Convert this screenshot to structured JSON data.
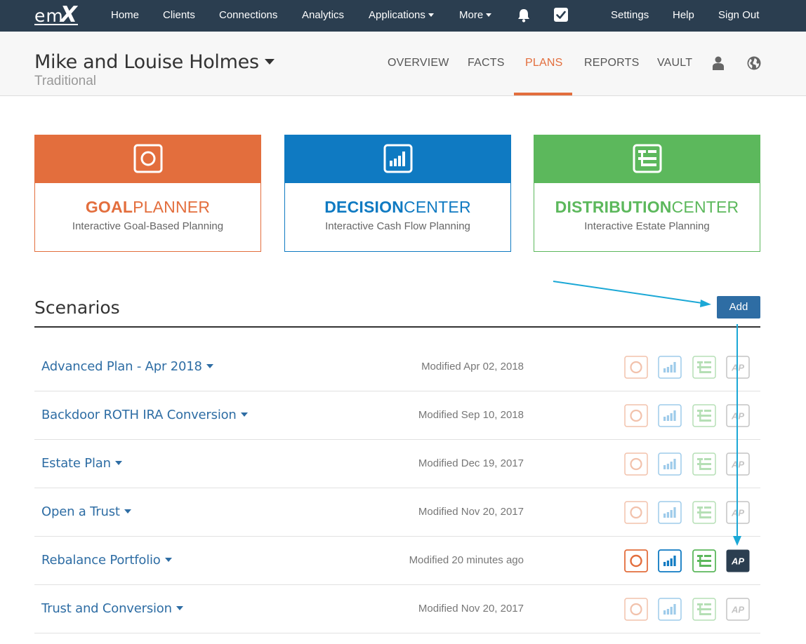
{
  "nav": {
    "logo_em": "em",
    "logo_x": "X",
    "home": "Home",
    "clients": "Clients",
    "connections": "Connections",
    "analytics": "Analytics",
    "applications": "Applications",
    "more": "More",
    "settings": "Settings",
    "help": "Help",
    "sign_out": "Sign Out",
    "bg_color": "#2b3e50"
  },
  "client": {
    "name": "Mike and Louise Holmes",
    "subtitle": "Traditional"
  },
  "tabs": [
    {
      "label": "OVERVIEW",
      "active": false
    },
    {
      "label": "FACTS",
      "active": false
    },
    {
      "label": "PLANS",
      "active": true
    },
    {
      "label": "REPORTS",
      "active": false
    },
    {
      "label": "VAULT",
      "active": false
    }
  ],
  "header_icons": [
    "user-icon",
    "globe-icon"
  ],
  "planners": [
    {
      "bold": "GOAL",
      "light": "PLANNER",
      "subtitle": "Interactive Goal-Based Planning",
      "color": "#e36e3d",
      "icon": "goal-planner-icon"
    },
    {
      "bold": "DECISION",
      "light": "CENTER",
      "subtitle": "Interactive Cash Flow Planning",
      "color": "#0f7ac2",
      "icon": "decision-center-icon"
    },
    {
      "bold": "DISTRIBUTION",
      "light": "CENTER",
      "subtitle": "Interactive Estate Planning",
      "color": "#5cb85c",
      "icon": "distribution-center-icon"
    }
  ],
  "scenarios": {
    "heading": "Scenarios",
    "add_label": "Add",
    "ap_label": "AP",
    "rows": [
      {
        "name": "Advanced Plan - Apr 2018",
        "modified": "Modified Apr 02, 2018",
        "active": false
      },
      {
        "name": "Backdoor ROTH IRA Conversion",
        "modified": "Modified Sep 10, 2018",
        "active": false
      },
      {
        "name": "Estate Plan",
        "modified": "Modified Dec 19, 2017",
        "active": false
      },
      {
        "name": "Open a Trust",
        "modified": "Modified Nov 20, 2017",
        "active": false
      },
      {
        "name": "Rebalance Portfolio",
        "modified": "Modified 20 minutes ago",
        "active": true
      },
      {
        "name": "Trust and Conversion",
        "modified": "Modified Nov 20, 2017",
        "active": false
      }
    ]
  },
  "annotation_color": "#1ba8d6"
}
